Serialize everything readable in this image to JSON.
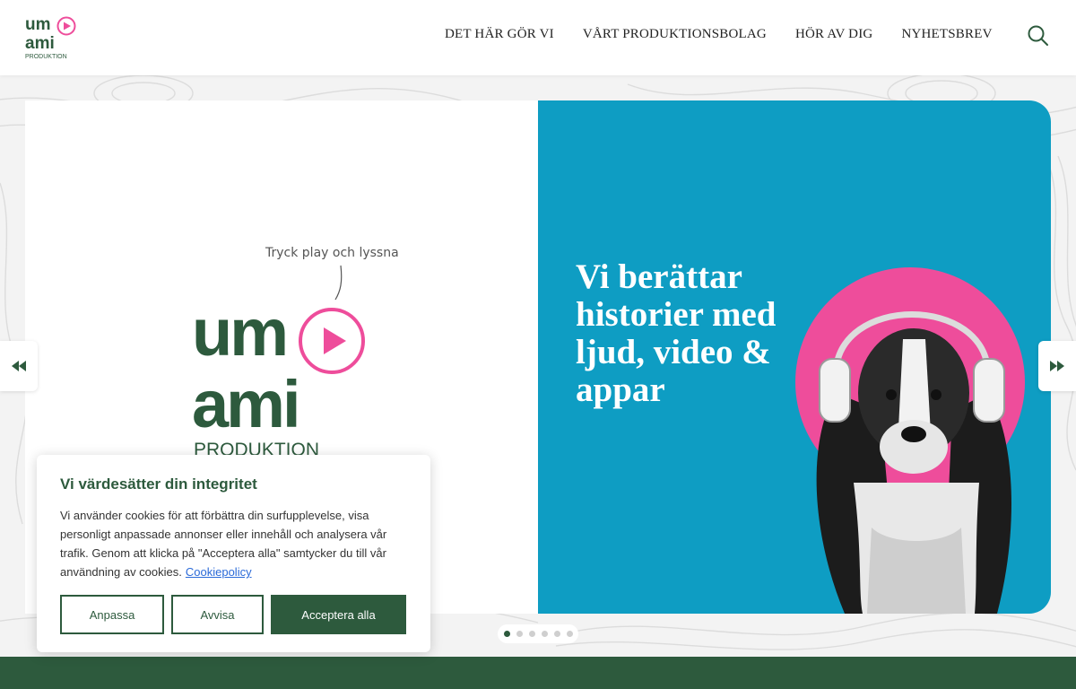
{
  "header": {
    "logo": {
      "top_text": "um",
      "mid_text": "ami",
      "sub_text": "PRODUKTION"
    },
    "nav": [
      {
        "label": "DET HÄR GÖR VI"
      },
      {
        "label": "VÅRT PRODUKTIONSBOLAG"
      },
      {
        "label": "HÖR AV DIG"
      },
      {
        "label": "NYHETSBREV"
      }
    ],
    "search_icon": "search-icon"
  },
  "slider": {
    "left_panel": {
      "annotation": "Tryck play och lyssna",
      "logo": {
        "top_text": "um",
        "mid_text": "ami",
        "sub_text": "PRODUKTION"
      }
    },
    "right_panel": {
      "tagline": "Vi berättar historier med ljud, video & appar"
    },
    "dots_count": 6,
    "active_dot": 1
  },
  "cookie": {
    "title": "Vi värdesätter din integritet",
    "body": "Vi använder cookies för att förbättra din surfupplevelse, visa personligt anpassade annonser eller innehåll och analysera vår trafik. Genom att klicka på \"Acceptera alla\" samtycker du till vår användning av cookies.",
    "link": "Cookiepolicy",
    "buttons": {
      "customize": "Anpassa",
      "reject": "Avvisa",
      "accept": "Acceptera alla"
    }
  },
  "colors": {
    "brand_green": "#2d5a3d",
    "brand_pink": "#ee4d9b",
    "slide_blue": "#0e9dc3",
    "link_blue": "#2b6ad8"
  }
}
